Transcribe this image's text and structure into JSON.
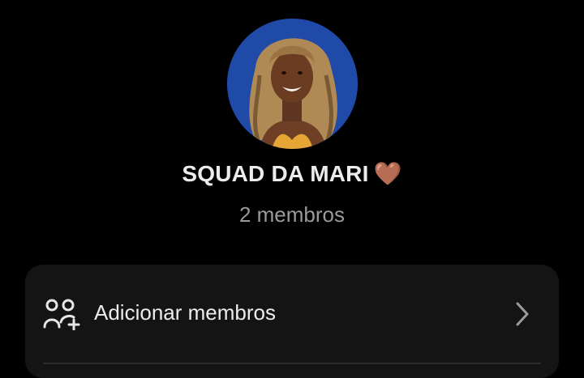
{
  "group": {
    "name": "SQUAD DA MARI",
    "emoji": "🤎",
    "member_count_label": "2 membros"
  },
  "actions": [
    {
      "label": "Adicionar membros",
      "icon": "add-members-icon"
    }
  ],
  "colors": {
    "background": "#000000",
    "card": "#141414",
    "avatar_background": "#1f4aa8",
    "heart": "#b57452"
  }
}
